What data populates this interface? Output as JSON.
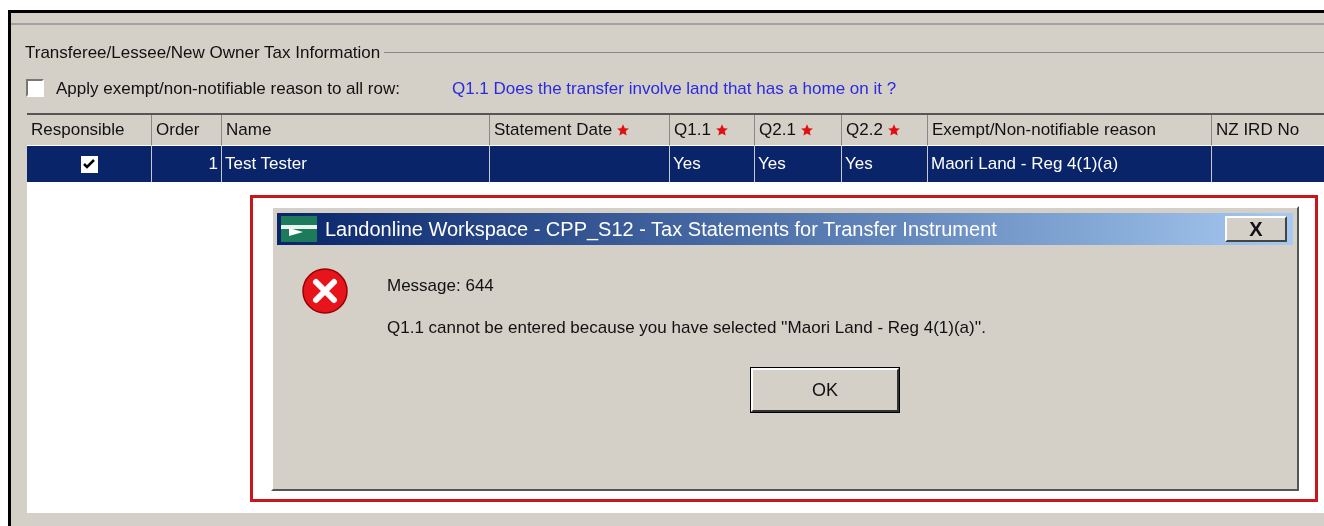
{
  "group": {
    "title": "Transferee/Lessee/New Owner Tax Information"
  },
  "apply_all": {
    "label": "Apply exempt/non-notifiable reason to all row:",
    "checked": false
  },
  "hint": "Q1.1 Does the transfer involve land that has a home on it ?",
  "table": {
    "columns": [
      {
        "label": "Responsible",
        "required": false
      },
      {
        "label": "Order",
        "required": false
      },
      {
        "label": "Name",
        "required": false
      },
      {
        "label": "Statement Date",
        "required": true
      },
      {
        "label": "Q1.1",
        "required": true
      },
      {
        "label": "Q2.1",
        "required": true
      },
      {
        "label": "Q2.2",
        "required": true
      },
      {
        "label": "Exempt/Non-notifiable reason",
        "required": false
      },
      {
        "label": "NZ IRD No",
        "required": false
      }
    ],
    "rows": [
      {
        "selected": true,
        "responsible": true,
        "order": "1",
        "name": "Test Tester",
        "q1_1": "Yes",
        "q2_1": "Yes",
        "q2_2": "Yes",
        "reason": "Maori Land - Reg 4(1)(a)"
      }
    ]
  },
  "dialog": {
    "title": "Landonline Workspace - CPP_S12 - Tax Statements for Transfer Instrument",
    "close": "X",
    "heading": "Message: 644",
    "message": "Q1.1 cannot be entered because you have selected ''Maori Land - Reg 4(1)(a)''.",
    "ok": "OK"
  }
}
